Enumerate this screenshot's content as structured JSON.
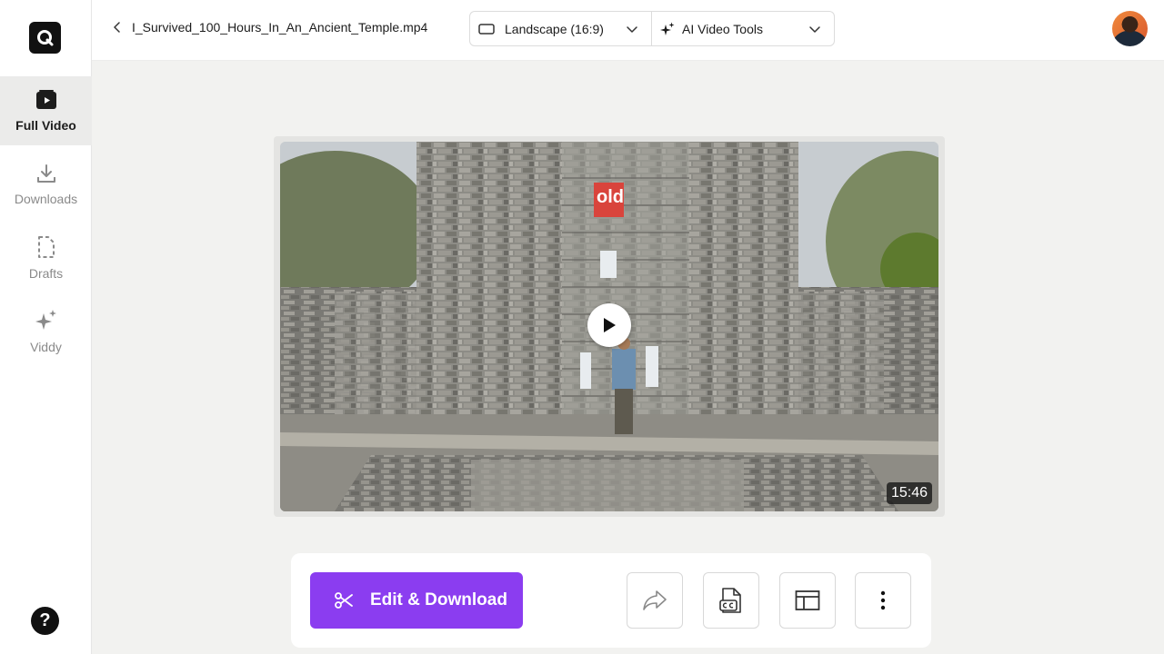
{
  "sidebar": {
    "items": [
      {
        "label": "Full Video",
        "icon": "play-square-icon",
        "active": true
      },
      {
        "label": "Downloads",
        "icon": "download-icon",
        "active": false
      },
      {
        "label": "Drafts",
        "icon": "draft-file-icon",
        "active": false
      },
      {
        "label": "Viddy",
        "icon": "sparkle-icon",
        "active": false
      }
    ],
    "help": "?"
  },
  "header": {
    "filename": "I_Survived_100_Hours_In_An_Ancient_Temple.mp4",
    "aspect": "Landscape (16:9)",
    "tools": "AI Video Tools"
  },
  "video": {
    "duration": "15:46",
    "overlay_text": "old"
  },
  "actions": {
    "edit_label": "Edit & Download"
  },
  "colors": {
    "accent": "#8b3df0",
    "sidebar_active": "#ebebea"
  }
}
